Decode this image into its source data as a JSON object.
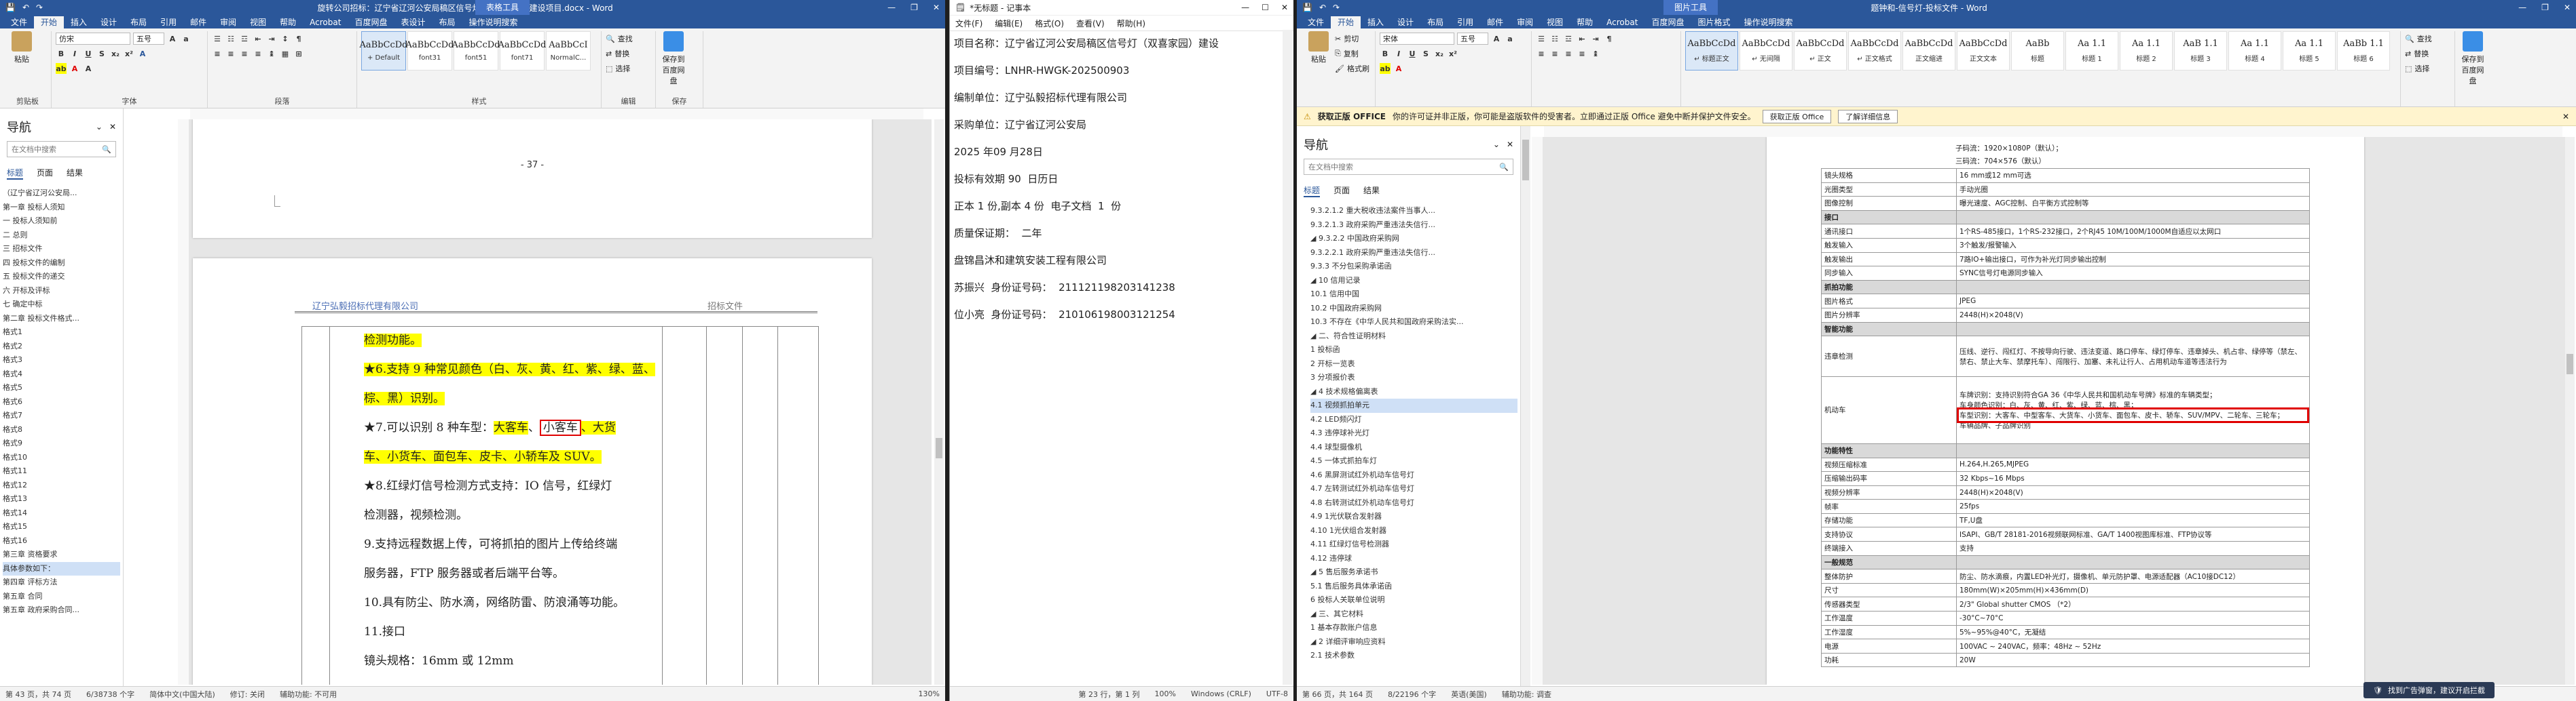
{
  "win1": {
    "title": "旋转公司招标：辽宁省辽河公安局稿区信号灯（双喜家园）建设项目.docx - Word",
    "context_tab": "表格工具",
    "tabs": [
      "文件",
      "开始",
      "插入",
      "设计",
      "布局",
      "引用",
      "邮件",
      "审阅",
      "视图",
      "帮助",
      "Acrobat",
      "百度网盘",
      "表设计",
      "布局"
    ],
    "tell_me": "操作说明搜索",
    "ribbon": {
      "paste": "粘贴",
      "clipboard": "剪贴板",
      "font_name": "仿宋",
      "font_size": "五号",
      "font_group": "字体",
      "para_group": "段落",
      "styles_group": "样式",
      "styles": [
        {
          "sample": "AaBbCcDd",
          "name": "+ Default"
        },
        {
          "sample": "AaBbCcDd",
          "name": "font31"
        },
        {
          "sample": "AaBbCcDd",
          "name": "font51"
        },
        {
          "sample": "AaBbCcDd",
          "name": "font71"
        },
        {
          "sample": "AaBbCcI",
          "name": "NormalC..."
        }
      ],
      "find": "查找",
      "replace": "替换",
      "select": "选择",
      "edit_group": "编辑",
      "save_baidu": "保存到百度网盘",
      "save_group": "保存"
    },
    "nav": {
      "title": "导航",
      "search_placeholder": "在文档中搜索",
      "tabs": [
        "标题",
        "页面",
        "结果"
      ],
      "items": [
        "（辽宁省辽河公安局...",
        "第一章 投标人须知",
        "一 投标人须知前",
        "二 总则",
        "三 招标文件",
        "四 投标文件的编制",
        "五 投标文件的递交",
        "六 开标及评标",
        "七 确定中标",
        "第二章 投标文件格式...",
        "格式1",
        "格式2",
        "格式3",
        "格式4",
        "格式5",
        "格式6",
        "格式7",
        "格式8",
        "格式9",
        "格式10",
        "格式11",
        "格式12",
        "格式13",
        "格式14",
        "格式15",
        "格式16",
        "第三章 资格要求",
        "具体参数如下：",
        "第四章 评标方法",
        "第五章 合同",
        "第五章 政府采购合同..."
      ]
    },
    "page_number": "- 37 -",
    "header_left": "辽宁弘毅招标代理有限公司",
    "header_right": "招标文件",
    "lines": {
      "l1": "检测功能。",
      "l2": "★6.支持 9 种常见颜色（白、灰、黄、红、紫、绿、蓝、棕、黑）识别。",
      "l3a": "★7.可以识别 8 种车型：",
      "l3b": "大客车",
      "l3c": "、",
      "l3d": "小客车",
      "l3e": "、大货",
      "l4": "车、小货车、面包车、皮卡、小轿车及 SUV。",
      "l5": "★8.红绿灯信号检测方式支持：IO 信号，红绿灯",
      "l6": "检测器，视频检测。",
      "l7": "9.支持远程数据上传，可将抓拍的图片上传给终端",
      "l8": "服务器，FTP 服务器或者后端平台等。",
      "l9": "10.具有防尘、防水滴，网络防雷、防浪涌等功能。",
      "l10": "11.接口",
      "l11": "镜头规格：16mm 或 12mm"
    },
    "status": [
      "第 43 页，共 74 页",
      "6/38738 个字",
      "简体中文(中国大陆)",
      "修订: 关闭",
      "辅助功能: 不可用"
    ],
    "zoom": "130%"
  },
  "win2": {
    "title": "*无标题 - 记事本",
    "menu": [
      "文件(F)",
      "编辑(E)",
      "格式(O)",
      "查看(V)",
      "帮助(H)"
    ],
    "lines": [
      "项目名称：辽宁省辽河公安局稿区信号灯（双喜家园）建设",
      "项目编号：LNHR-HWGK-202500903",
      "编制单位：辽宁弘毅招标代理有限公司",
      "采购单位：辽宁省辽河公安局",
      "2025 年09 月28日",
      "投标有效期 90  日历日",
      "正本 1 份,副本 4 份  电子文档  1  份",
      "质量保证期：  二年",
      "盘锦昌沐和建筑安装工程有限公司",
      "苏振兴  身份证号码：  211121198203141238",
      "位小亮  身份证号码：  210106198003121254"
    ],
    "status": [
      "第 23 行，第 1 列",
      "100%",
      "Windows (CRLF)",
      "UTF-8"
    ]
  },
  "win3": {
    "title": "题钟和-信号灯-投标文件 - Word",
    "context_tab": "图片工具",
    "tabs": [
      "文件",
      "开始",
      "插入",
      "设计",
      "布局",
      "引用",
      "邮件",
      "审阅",
      "视图",
      "帮助",
      "Acrobat",
      "百度网盘",
      "图片格式"
    ],
    "tell_me": "操作说明搜索",
    "ribbon": {
      "cut": "剪切",
      "copy": "复制",
      "painter": "格式刷",
      "paste": "粘贴",
      "font_name": "宋体",
      "font_size": "五号",
      "styles": [
        {
          "sample": "AaBbCcDd",
          "name": "↵ 标题正文"
        },
        {
          "sample": "AaBbCcDd",
          "name": "↵ 无间隔"
        },
        {
          "sample": "AaBbCcDd",
          "name": "↵ 正文"
        },
        {
          "sample": "AaBbCcDd",
          "name": "↵ 正文格式"
        },
        {
          "sample": "AaBbCcDd",
          "name": "正文缩进"
        },
        {
          "sample": "AaBbCcDd",
          "name": "正文文本"
        },
        {
          "sample": "AaBb",
          "name": "标题"
        },
        {
          "sample": "Aa 1.1",
          "name": "标题 1"
        },
        {
          "sample": "Aa 1.1",
          "name": "标题 2"
        },
        {
          "sample": "AaB 1.1",
          "name": "标题 3"
        },
        {
          "sample": "Aa 1.1",
          "name": "标题 4"
        },
        {
          "sample": "Aa 1.1",
          "name": "标题 5"
        },
        {
          "sample": "AaBb 1.1",
          "name": "标题 6"
        }
      ],
      "find": "查找",
      "replace": "替换",
      "select": "选择",
      "save_baidu": "保存到百度网盘"
    },
    "msgbar": {
      "label": "获取正版 OFFICE",
      "text": "你的许可证并非正版，你可能是盗版软件的受害者。立即通过正版 Office 避免中断并保护文件安全。",
      "btn1": "获取正版 Office",
      "btn2": "了解详细信息"
    },
    "nav": {
      "title": "导航",
      "search_placeholder": "在文档中搜索",
      "tabs": [
        "标题",
        "页面",
        "结果"
      ],
      "items": [
        "9.3.2.1.2 重大税收违法案件当事人...",
        "9.3.2.1.3 政府采购严重违法失信行...",
        "◢ 9.3.2.2 中国政府采购网",
        "9.3.2.2.1 政府采购严重违法失信行...",
        "9.3.3 不分包采购承诺函",
        "◢ 10 信用记录",
        "10.1 信用中国",
        "10.2 中国政府采购网",
        "10.3 不存在《中华人民共和国政府采购法实...",
        "◢ 二、符合性证明材料",
        "1 投标函",
        "2 开标一览表",
        "3 分项报价表",
        "◢ 4 技术规格偏离表",
        "4.1 视频抓拍单元",
        "4.2 LED频闪灯",
        "4.3 违停球补光灯",
        "4.4 球型摄像机",
        "4.5 一体式抓拍车灯",
        "4.6 黑屏测试红外机动车信号灯",
        "4.7 左转测试红外机动车信号灯",
        "4.8 右转测试红外机动车信号灯",
        "4.9 1光伏联合发射器",
        "4.10 1光伏组合发射器",
        "4.11 红绿灯信号检测器",
        "4.12 违停球",
        "◢ 5 售后服务承诺书",
        "5.1 售后服务具体承诺函",
        "6 投标人关联单位说明",
        "◢ 三、其它材料",
        "1 基本存款账户信息",
        "◢ 2 详细评审响应资料",
        "2.1 技术参数"
      ],
      "selected": 14
    },
    "spec": {
      "pre": [
        "子码流：1920×1080P（默认）；",
        "三码流：704×576（默认）"
      ],
      "rows": [
        {
          "k": "镜头规格",
          "v": "16 mm或12 mm可选"
        },
        {
          "k": "光圈类型",
          "v": "手动光圈"
        },
        {
          "k": "图像控制",
          "v": "曝光速度、AGC控制、白平衡方式控制等"
        },
        {
          "k": "接口",
          "v": "",
          "sec": true
        },
        {
          "k": "通讯接口",
          "v": "1个RS-485接口，1个RS-232接口，2个RJ45 10M/100M/1000M自适应以太网口"
        },
        {
          "k": "触发输入",
          "v": "3个触发/报警输入"
        },
        {
          "k": "触发输出",
          "v": "7路IO+输出接口，可作为补光灯同步输出控制"
        },
        {
          "k": "同步输入",
          "v": "SYNC信号灯电源同步输入"
        },
        {
          "k": "抓拍功能",
          "v": "",
          "sec": true
        },
        {
          "k": "图片格式",
          "v": "JPEG"
        },
        {
          "k": "图片分辨率",
          "v": "2448(H)×2048(V)"
        },
        {
          "k": "智能功能",
          "v": "",
          "sec": true
        },
        {
          "k": "违章检测",
          "v": "压线、逆行、闯红灯、不按导向行驶、违法变道、路口停车、绿灯停车、违章掉头、机占非、绿停等（禁左、禁右、禁止大车、禁摩托车）、闯限行、加塞、未礼让行人、占用机动车道等违法行为",
          "h": 3
        },
        {
          "k": "机动车",
          "v": "车牌识别：支持识别符合GA 36《中华人民共和国机动车号牌》标准的车辆类型；|车身颜色识别：白、灰、黄、红、紫、绿、蓝、棕、黑；|车型识别：大客车、中型客车、大货车、小货车、面包车、皮卡、轿车、SUV/MPV、二轮车、三轮车；|车辆品牌、子品牌识别",
          "h": 5,
          "box": 2
        },
        {
          "k": "功能特性",
          "v": "",
          "sec": true
        },
        {
          "k": "视频压缩标准",
          "v": "H.264,H.265,MJPEG"
        },
        {
          "k": "压缩输出码率",
          "v": "32 Kbps~16 Mbps"
        },
        {
          "k": "视频分辨率",
          "v": "2448(H)×2048(V)"
        },
        {
          "k": "帧率",
          "v": "25fps"
        },
        {
          "k": "存储功能",
          "v": "TF,U盘"
        },
        {
          "k": "支持协议",
          "v": "ISAPI、GB/T 28181-2016视频联网标准、GA/T 1400视图库标准、FTP协议等"
        },
        {
          "k": "终端接入",
          "v": "支持"
        },
        {
          "k": "一般规范",
          "v": "",
          "sec": true
        },
        {
          "k": "整体防护",
          "v": "防尘、防水滴痕，内置LED补光灯，摄像机、单元防护罩、电源适配器（AC10接DC12）"
        },
        {
          "k": "尺寸",
          "v": "180mm(W)×205mm(H)×436mm(D)"
        },
        {
          "k": "传感器类型",
          "v": "2/3\" Global shutter CMOS （*2）"
        },
        {
          "k": "工作温度",
          "v": "-30°C~70°C"
        },
        {
          "k": "工作湿度",
          "v": "5%~95%@40°C，无凝结"
        },
        {
          "k": "电源",
          "v": "100VAC ~ 240VAC，频率：48Hz ~ 52Hz"
        },
        {
          "k": "功耗",
          "v": "20W"
        }
      ]
    },
    "status": [
      "第 66 页，共 164 页",
      "8/22196 个字",
      "英语(美国)",
      "辅助功能: 调查"
    ],
    "toast": "找到广告弹窗，建议开启拦截"
  },
  "colors": {
    "word_blue": "#2b579a",
    "highlight": "#ffff00",
    "redbox": "#e00000",
    "msgbar": "#fff4ce"
  }
}
